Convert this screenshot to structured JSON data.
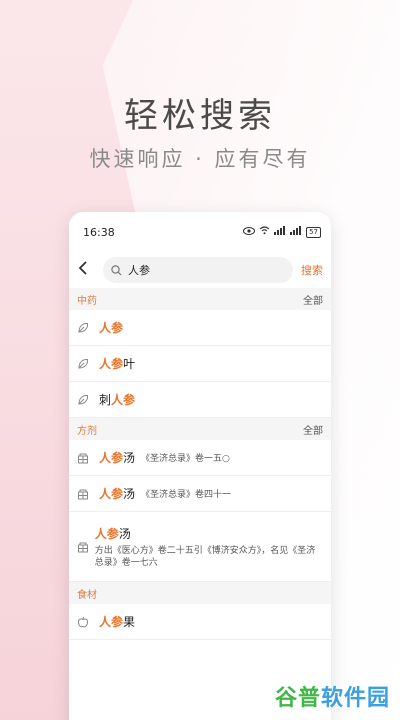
{
  "hero": {
    "title": "轻松搜索",
    "subtitle": "快速响应 · 应有尽有"
  },
  "status_bar": {
    "time": "16:38",
    "battery": "57"
  },
  "search": {
    "query": "人参",
    "button_label": "搜索"
  },
  "sections": [
    {
      "name": "中药",
      "all_label": "全部",
      "items": [
        {
          "prefix": "",
          "highlight": "人参",
          "suffix": "",
          "icon": "leaf-icon"
        },
        {
          "prefix": "",
          "highlight": "人参",
          "suffix": "叶",
          "icon": "leaf-icon"
        },
        {
          "prefix": "刺",
          "highlight": "人参",
          "suffix": "",
          "icon": "leaf-icon"
        }
      ]
    },
    {
      "name": "方剂",
      "all_label": "全部",
      "items": [
        {
          "highlight": "人参",
          "suffix": "汤",
          "ref": "《圣济总录》卷一五○",
          "icon": "pill-box-icon"
        },
        {
          "highlight": "人参",
          "suffix": "汤",
          "ref": "《圣济总录》卷四十一",
          "icon": "pill-box-icon"
        },
        {
          "highlight": "人参",
          "suffix": "汤",
          "desc": "方出《医心方》卷二十五引《博济安众方》，名见《圣济总录》卷一七六",
          "icon": "pill-box-icon"
        }
      ]
    },
    {
      "name": "食材",
      "items": [
        {
          "highlight": "人参",
          "suffix": "果",
          "icon": "apple-icon"
        }
      ]
    }
  ],
  "watermark": {
    "part1": "谷普",
    "part2": "软件园"
  },
  "colors": {
    "accent": "#e8742d",
    "section_title": "#e07a3c"
  }
}
